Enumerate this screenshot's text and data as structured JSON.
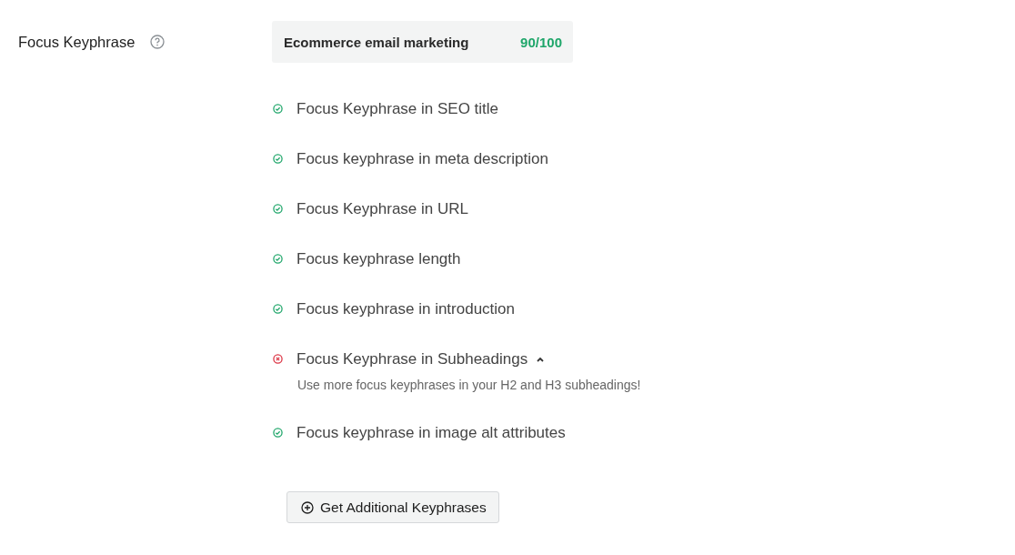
{
  "field": {
    "label": "Focus Keyphrase",
    "keyphrase": "Ecommerce email marketing",
    "score": "90/100"
  },
  "checks": [
    {
      "kind": "pass",
      "text": "Focus Keyphrase in SEO title"
    },
    {
      "kind": "pass",
      "text": "Focus keyphrase in meta description"
    },
    {
      "kind": "pass",
      "text": "Focus Keyphrase in URL"
    },
    {
      "kind": "pass",
      "text": "Focus keyphrase length"
    },
    {
      "kind": "pass",
      "text": "Focus keyphrase in introduction"
    },
    {
      "kind": "fail",
      "text": "Focus Keyphrase in Subheadings",
      "expanded": true,
      "detail": "Use more focus keyphrases in your H2 and H3 subheadings!"
    },
    {
      "kind": "pass",
      "text": "Focus keyphrase in image alt attributes"
    }
  ],
  "button": {
    "label": "Get Additional Keyphrases"
  }
}
